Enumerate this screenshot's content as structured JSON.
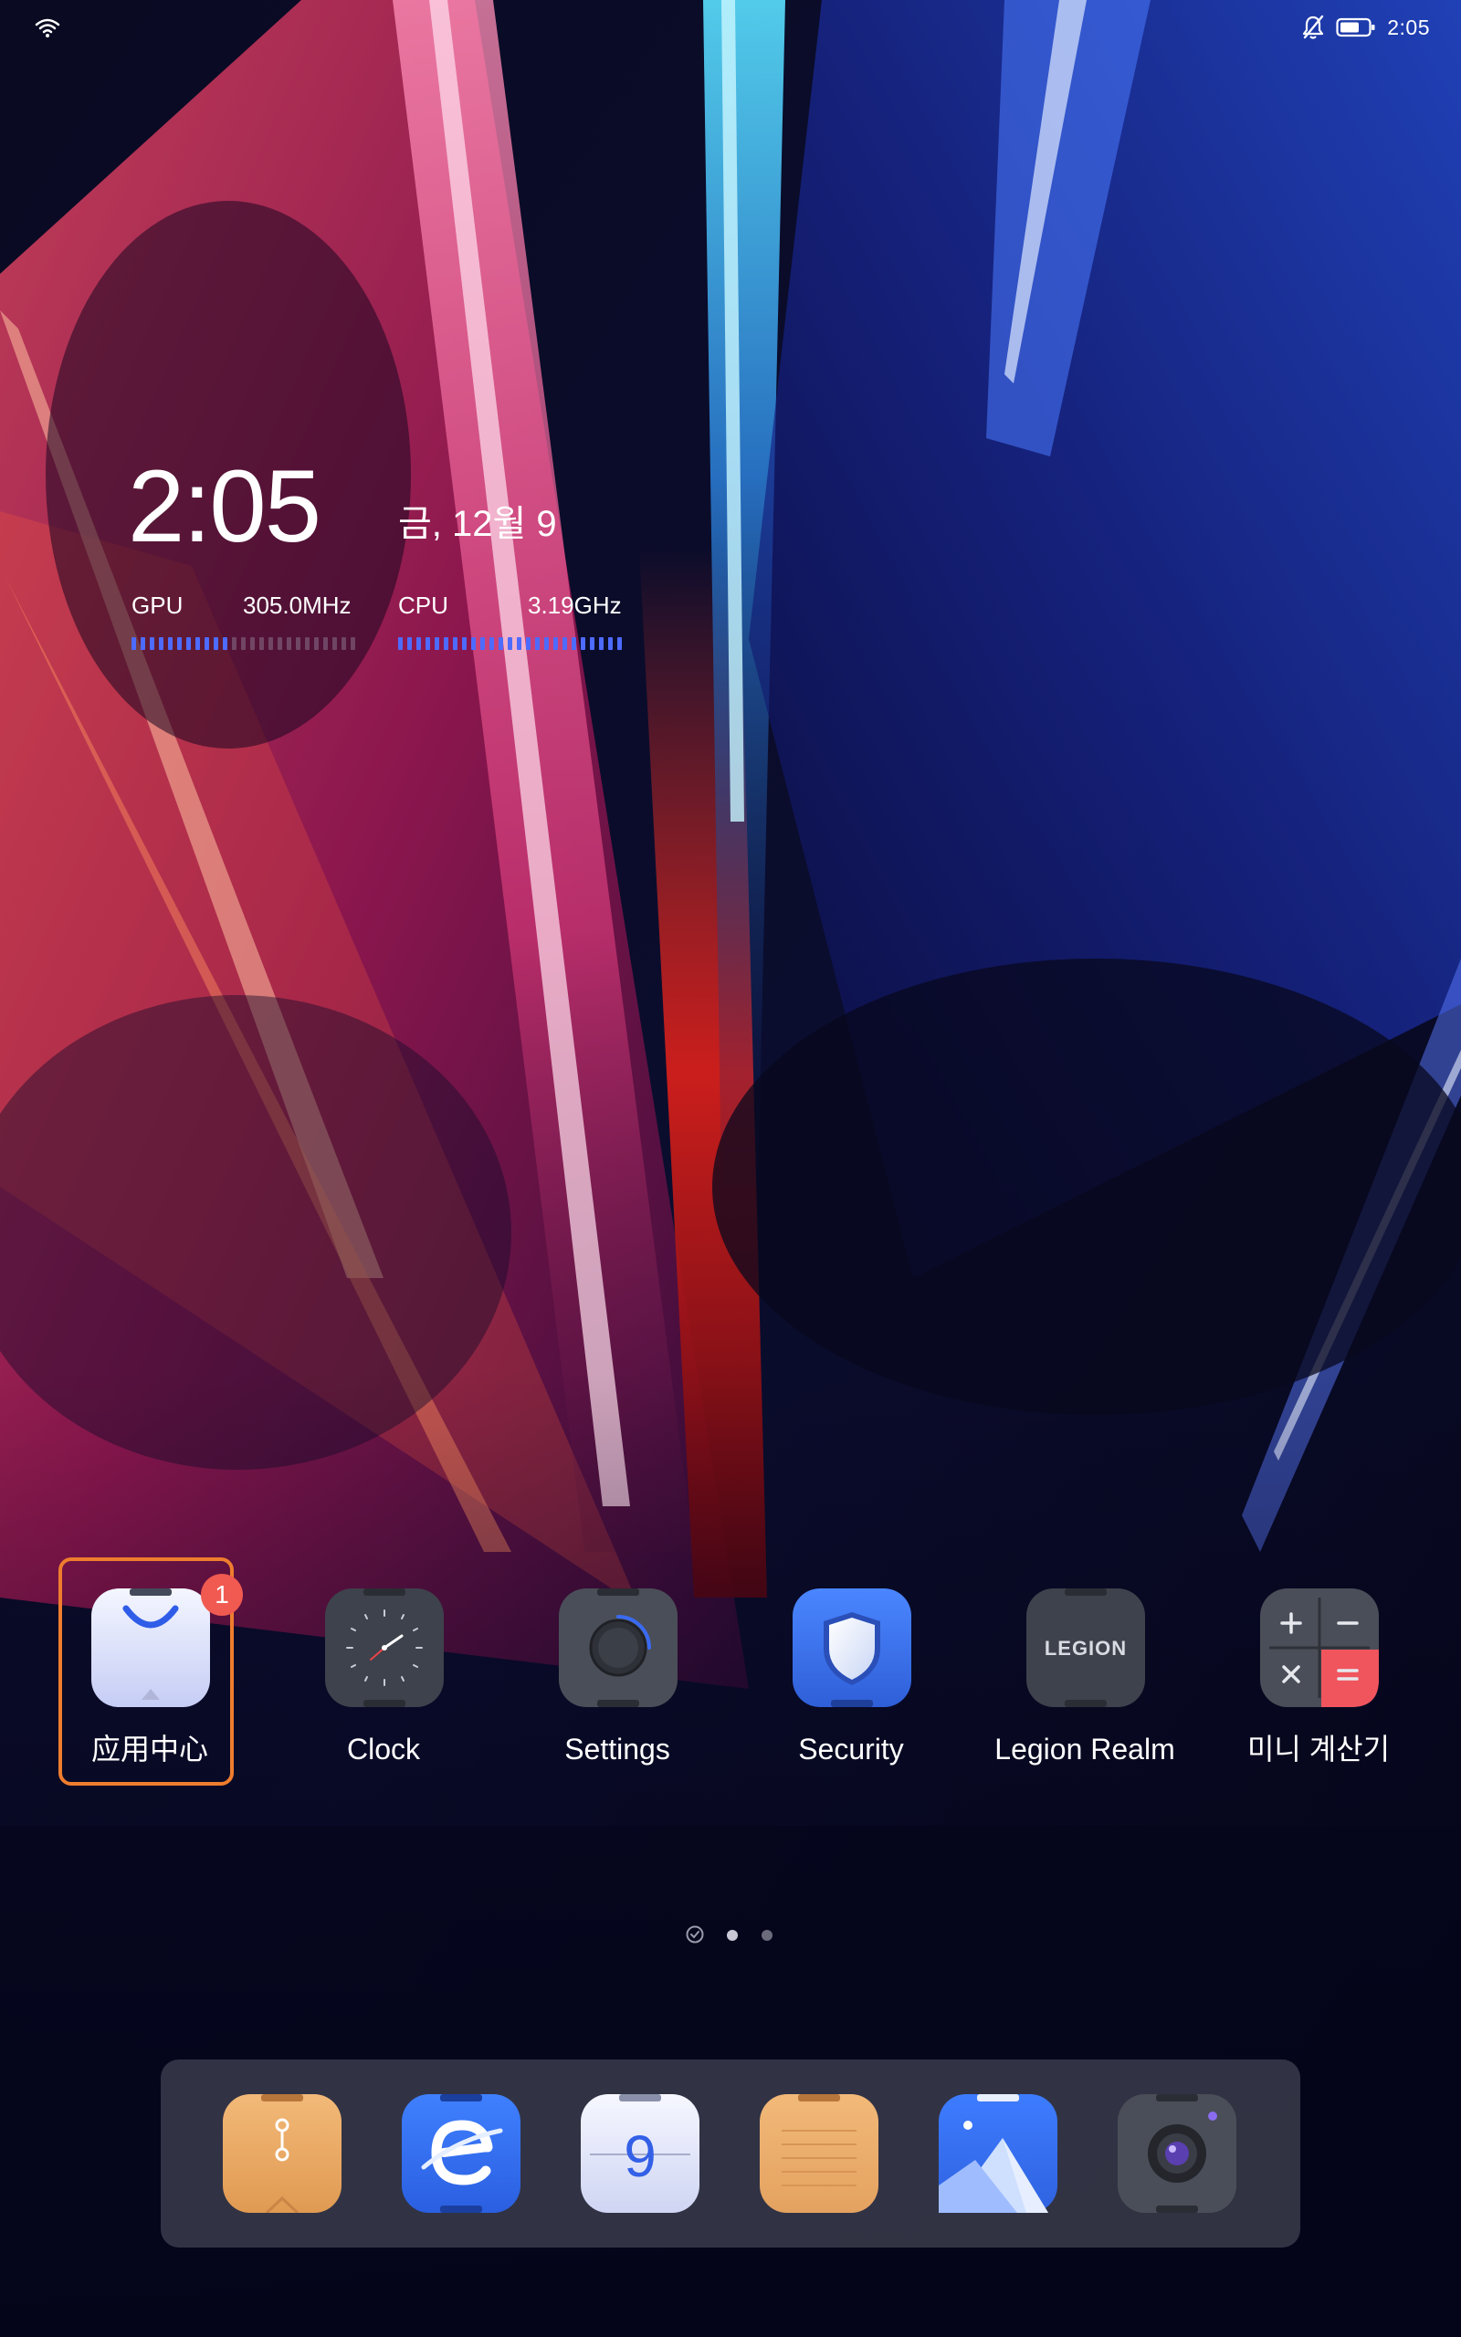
{
  "status_bar": {
    "time": "2:05",
    "icons": [
      "wifi-icon",
      "bell-off-icon",
      "battery-icon"
    ]
  },
  "widget": {
    "time": "2:05",
    "date": "금, 12월 9",
    "gpu_label": "GPU",
    "gpu_value": "305.0MHz",
    "gpu_level": 0.45,
    "cpu_label": "CPU",
    "cpu_value": "3.19GHz",
    "cpu_level": 1.0
  },
  "apps": [
    {
      "label": "应用中心",
      "icon": "app-center-icon",
      "badge": "1",
      "focused": true
    },
    {
      "label": "Clock",
      "icon": "clock-icon"
    },
    {
      "label": "Settings",
      "icon": "settings-icon"
    },
    {
      "label": "Security",
      "icon": "security-icon"
    },
    {
      "label": "Legion Realm",
      "icon": "legion-realm-icon",
      "icon_text": "LEGION"
    },
    {
      "label": "미니 계산기",
      "icon": "calculator-icon"
    }
  ],
  "pager": {
    "pages": 3,
    "active_page": 2
  },
  "dock": [
    {
      "icon": "file-manager-icon"
    },
    {
      "icon": "browser-icon"
    },
    {
      "icon": "calendar-icon",
      "icon_text": "9"
    },
    {
      "icon": "notes-icon"
    },
    {
      "icon": "gallery-icon"
    },
    {
      "icon": "camera-icon"
    }
  ],
  "colors": {
    "focus_ring": "#ee7d2e",
    "badge": "#f05a50",
    "meter_on": "#4d6bff",
    "security_blue": "#3d6ee6",
    "browser_blue": "#2f6ff0",
    "calc_equals": "#f0555e"
  }
}
